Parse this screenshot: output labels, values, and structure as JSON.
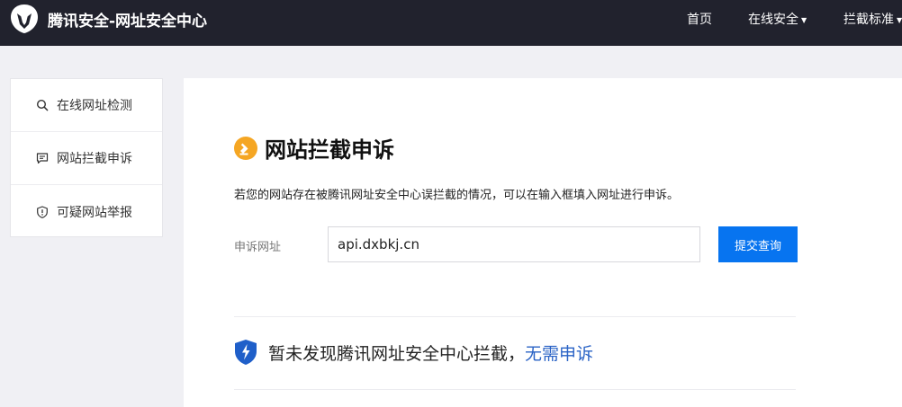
{
  "header": {
    "brand_title": "腾讯安全-网址安全中心",
    "nav": {
      "home": "首页",
      "online_security": "在线安全",
      "block_standard": "拦截标准"
    }
  },
  "sidebar": {
    "items": [
      {
        "label": "在线网址检测",
        "icon": "search-icon"
      },
      {
        "label": "网站拦截申诉",
        "icon": "message-icon"
      },
      {
        "label": "可疑网站举报",
        "icon": "shield-alert-icon"
      }
    ]
  },
  "main": {
    "title": "网站拦截申诉",
    "description": "若您的网站存在被腾讯网址安全中心误拦截的情况，可以在输入框填入网址进行申诉。",
    "form": {
      "label": "申诉网址",
      "input_value": "api.dxbkj.cn",
      "submit_label": "提交查询"
    },
    "result": {
      "text": "暂未发现腾讯网址安全中心拦截，",
      "link": "无需申诉"
    }
  },
  "colors": {
    "topbar": "#21222d",
    "primary_button": "#0774f0",
    "link": "#2a63c6",
    "heading_icon": "#f5a623",
    "result_icon": "#1f5fc9"
  }
}
